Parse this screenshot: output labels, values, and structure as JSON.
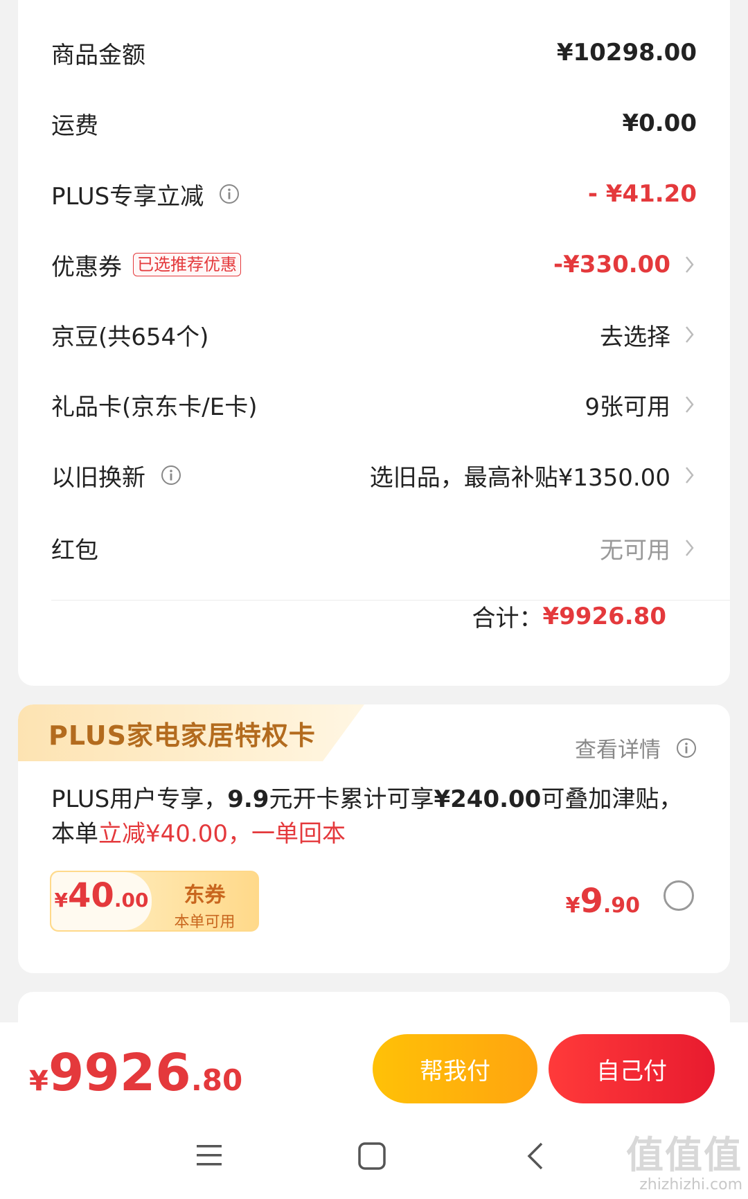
{
  "summary": {
    "goods_amount": {
      "label": "商品金额",
      "value": "¥10298.00"
    },
    "shipping": {
      "label": "运费",
      "value": "¥0.00"
    },
    "plus_discount": {
      "label": "PLUS专享立减",
      "value": "- ¥41.20"
    },
    "coupon": {
      "label": "优惠券",
      "tag": "已选推荐优惠",
      "value": "-¥330.00"
    },
    "jingdou": {
      "label": "京豆(共654个)",
      "value": "去选择"
    },
    "gift_card": {
      "label": "礼品卡(京东卡/E卡)",
      "value": "9张可用"
    },
    "trade_in": {
      "label": "以旧换新",
      "value": "选旧品，最高补贴¥1350.00"
    },
    "red_packet": {
      "label": "红包",
      "value": "无可用"
    },
    "total": {
      "label": "合计：",
      "value": "¥9926.80"
    }
  },
  "plus_card": {
    "title": "PLUS家电家居特权卡",
    "detail_link": "查看详情",
    "desc_part1": "PLUS用户专享，",
    "desc_part2": "9.9",
    "desc_part3": "元开卡累计可享",
    "desc_part4": "¥240.00",
    "desc_part5": "可叠加津贴，本单",
    "desc_highlight": "立减¥40.00，一单回本",
    "coupon": {
      "symbol": "¥",
      "amount_int": "40",
      "amount_dec": ".00",
      "title": "东券",
      "subtitle": "本单可用"
    },
    "price": {
      "symbol": "¥",
      "int": "9",
      "dec": ".90"
    },
    "selected": false
  },
  "bottom": {
    "total": {
      "symbol": "¥",
      "int": "9926",
      "dec": ".80"
    },
    "help_pay": "帮我付",
    "self_pay": "自己付"
  },
  "nav": {
    "icons": [
      "menu-icon",
      "home-icon",
      "back-icon"
    ]
  },
  "watermark": {
    "logo": "值值值",
    "site": "zhizhizhi.com"
  },
  "colors": {
    "accent_red": "#e4393c",
    "gold": "#ffb30f",
    "plus_brown": "#b36b1e"
  }
}
